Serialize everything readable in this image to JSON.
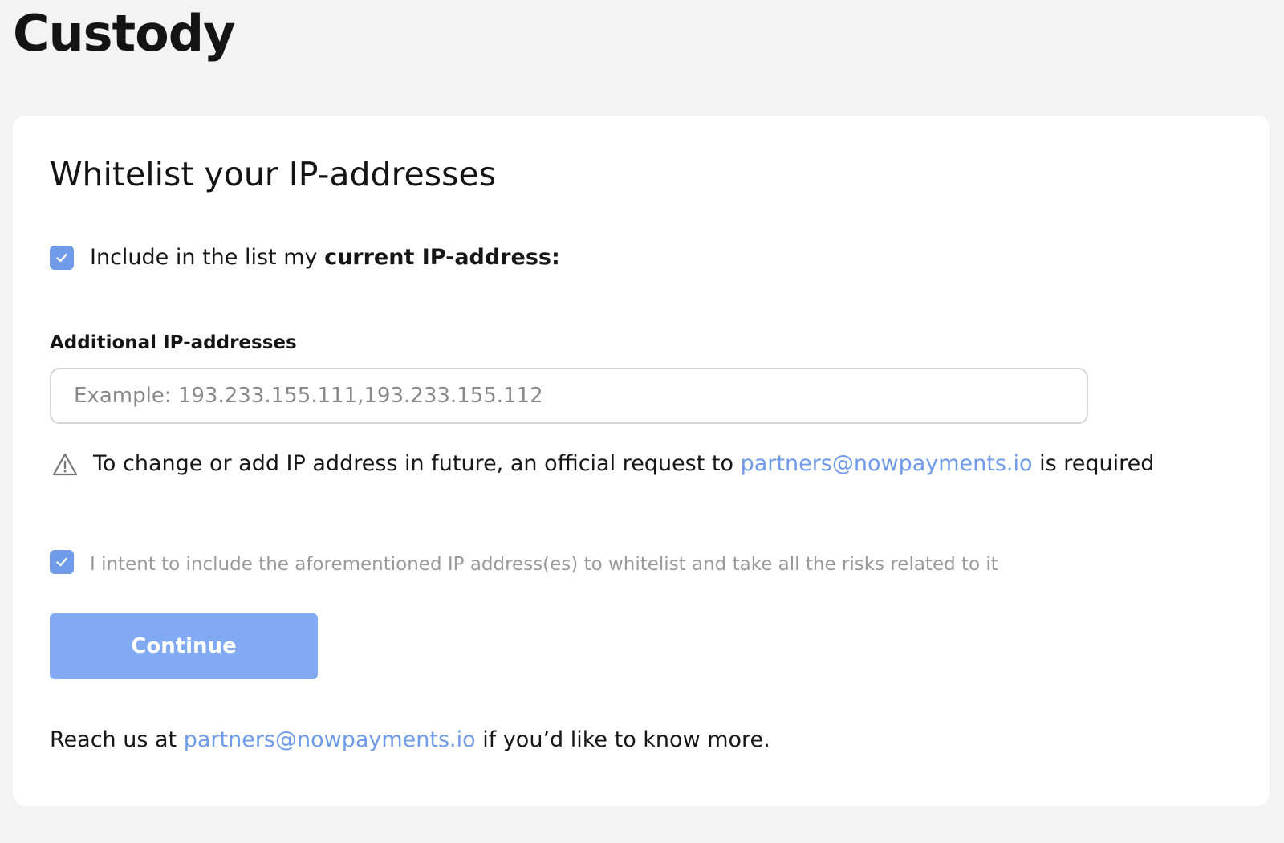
{
  "page": {
    "title": "Custody"
  },
  "card": {
    "title": "Whitelist your IP-addresses",
    "current_ip": {
      "checked": true,
      "label_prefix": "Include in the list my ",
      "label_bold": "current IP-address:",
      "value": ""
    },
    "additional_ips": {
      "label": "Additional IP-addresses",
      "value": "",
      "placeholder": "Example: 193.233.155.111,193.233.155.112"
    },
    "warning": {
      "icon": "warning-triangle-icon",
      "text_before": "To change or add IP address in future, an official request to ",
      "email": "partners@nowpayments.io",
      "text_after": " is required"
    },
    "consent": {
      "checked": true,
      "label": "I intent to include the aforementioned IP address(es) to whitelist and take all the risks related to it"
    },
    "continue_label": "Continue",
    "footer": {
      "text_before": "Reach us at ",
      "email": "partners@nowpayments.io",
      "text_after": " if you’d like to know more."
    }
  },
  "colors": {
    "accent": "#6f9be8",
    "button": "#82aaf2",
    "background": "#f3f3f3",
    "card": "#ffffff"
  }
}
